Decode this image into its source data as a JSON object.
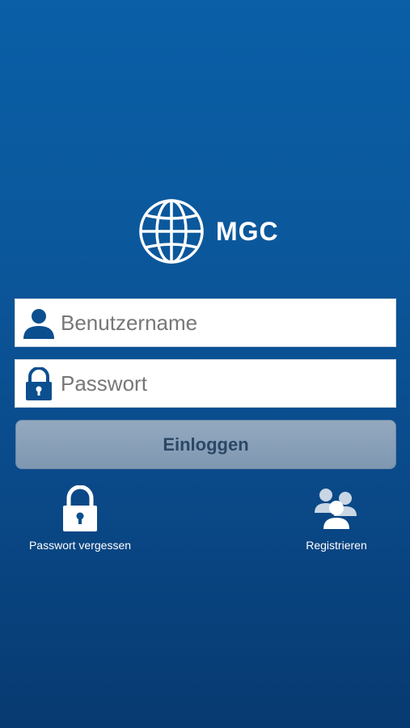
{
  "brand": {
    "name": "MGC",
    "logo_icon": "globe-icon"
  },
  "form": {
    "username": {
      "placeholder": "Benutzername",
      "value": "",
      "icon": "user-icon"
    },
    "password": {
      "placeholder": "Passwort",
      "value": "",
      "icon": "lock-icon"
    },
    "login_label": "Einloggen"
  },
  "actions": {
    "forgot_password": {
      "label": "Passwort vergessen",
      "icon": "padlock-icon"
    },
    "register": {
      "label": "Registrieren",
      "icon": "users-icon"
    }
  },
  "colors": {
    "background_top": "#0a5fa6",
    "background_bottom": "#073a70",
    "field_icon": "#0b4f8f",
    "button_fill": "#8aa1b9",
    "button_text": "#2b4766"
  }
}
